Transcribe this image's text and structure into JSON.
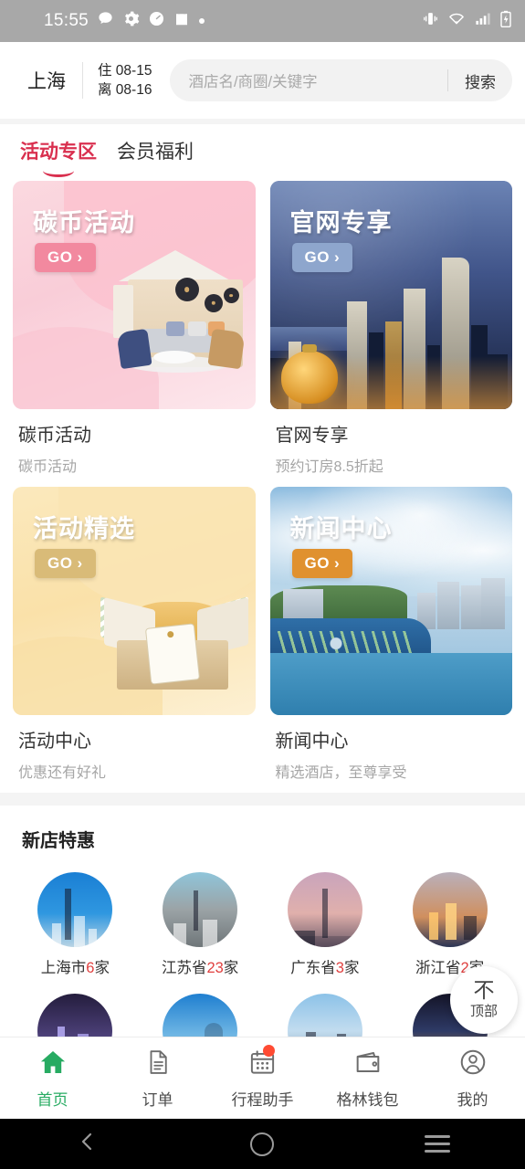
{
  "status_bar": {
    "time": "15:55",
    "left_icons": [
      "chat-bubble-icon",
      "gear-icon",
      "speedometer-icon",
      "shopping-bag-icon",
      "dot-icon"
    ],
    "right_icons": [
      "vibrate-icon",
      "wifi-icon",
      "signal-icon",
      "battery-charging-icon"
    ]
  },
  "search_header": {
    "city": "上海",
    "checkin": "住 08-15",
    "checkout": "离 08-16",
    "placeholder": "酒店名/商圈/关键字",
    "search_button": "搜索"
  },
  "tabs": [
    {
      "label": "活动专区",
      "active": true
    },
    {
      "label": "会员福利",
      "active": false
    }
  ],
  "promos": [
    {
      "banner_title": "碳币活动",
      "go_label": "GO",
      "go_color": "#f2899f",
      "name": "碳币活动",
      "subtitle": "碳币活动"
    },
    {
      "banner_title": "官网专享",
      "go_label": "GO",
      "go_color": "#8ea6cd",
      "name": "官网专享",
      "subtitle": "预约订房8.5折起"
    },
    {
      "banner_title": "活动精选",
      "go_label": "GO",
      "go_color": "#d9bb78",
      "name": "活动中心",
      "subtitle": "优惠还有好礼"
    },
    {
      "banner_title": "新闻中心",
      "go_label": "GO",
      "go_color": "#e0912f",
      "name": "新闻中心",
      "subtitle": "精选酒店，至尊享受"
    }
  ],
  "new_store": {
    "title": "新店特惠",
    "cities": [
      {
        "prefix": "上海市",
        "count": "6",
        "suffix": "家"
      },
      {
        "prefix": "江苏省",
        "count": "23",
        "suffix": "家"
      },
      {
        "prefix": "广东省",
        "count": "3",
        "suffix": "家"
      },
      {
        "prefix": "浙江省",
        "count": "2",
        "suffix": "家"
      },
      {
        "prefix": "",
        "count": "",
        "suffix": ""
      },
      {
        "prefix": "",
        "count": "",
        "suffix": ""
      },
      {
        "prefix": "",
        "count": "",
        "suffix": ""
      },
      {
        "prefix": "",
        "count": "",
        "suffix": ""
      }
    ]
  },
  "back_to_top": {
    "arrow": "不",
    "label": "顶部"
  },
  "bottom_nav": [
    {
      "label": "首页",
      "icon": "home-icon",
      "active": true,
      "badge": false
    },
    {
      "label": "订单",
      "icon": "document-icon",
      "active": false,
      "badge": false
    },
    {
      "label": "行程助手",
      "icon": "calendar-icon",
      "active": false,
      "badge": true
    },
    {
      "label": "格林钱包",
      "icon": "wallet-icon",
      "active": false,
      "badge": false
    },
    {
      "label": "我的",
      "icon": "person-icon",
      "active": false,
      "badge": false
    }
  ],
  "android_nav": [
    "back-icon",
    "home-icon",
    "recents-icon"
  ],
  "colors": {
    "accent_red": "#d9304f",
    "count_red": "#e0403f",
    "active_green": "#27ab62",
    "badge_red": "#ff4b33"
  }
}
